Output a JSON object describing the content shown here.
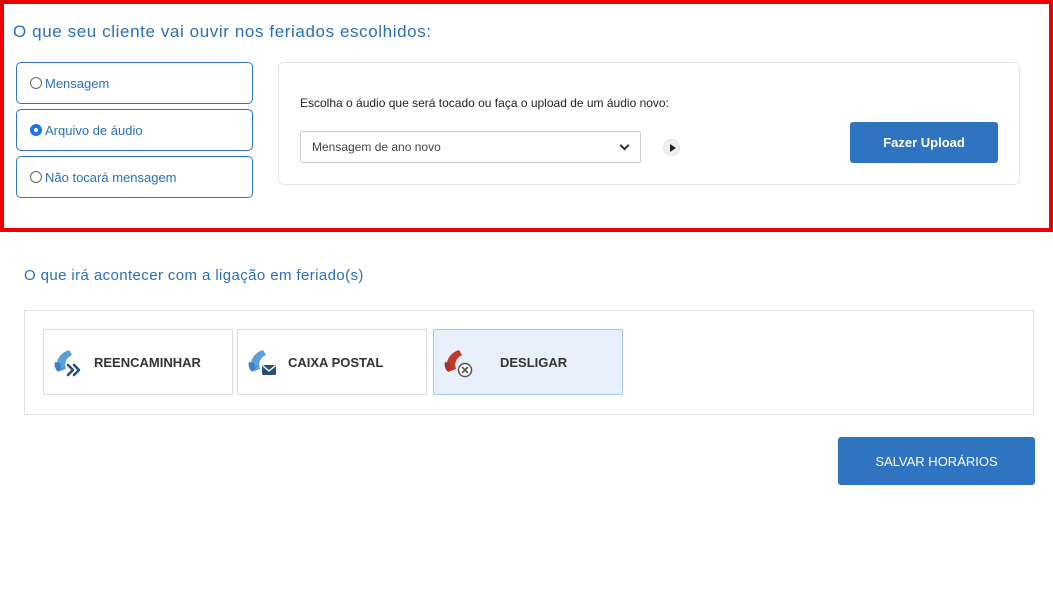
{
  "holiday_audio": {
    "title": "O que seu cliente vai ouvir nos feriados escolhidos:",
    "options": [
      {
        "label": "Mensagem",
        "selected": false
      },
      {
        "label": "Arquivo de áudio",
        "selected": true
      },
      {
        "label": "Não tocará mensagem",
        "selected": false
      }
    ],
    "instruction": "Escolha o áudio que será tocado ou faça o upload de um áudio novo:",
    "selected_audio": "Mensagem de ano novo",
    "upload_label": "Fazer Upload"
  },
  "call_action": {
    "title": "O que irá acontecer com a ligação em feriado(s)",
    "actions": [
      {
        "label": "REENCAMINHAR",
        "icon": "phone-forward-icon",
        "selected": false
      },
      {
        "label": "CAIXA POSTAL",
        "icon": "phone-voicemail-icon",
        "selected": false
      },
      {
        "label": "DESLIGAR",
        "icon": "phone-hangup-icon",
        "selected": true
      }
    ]
  },
  "save_label": "SALVAR HORÁRIOS",
  "colors": {
    "accent": "#2f74c0",
    "highlight_border": "#ee0000",
    "hangup_icon": "#c0392b"
  }
}
